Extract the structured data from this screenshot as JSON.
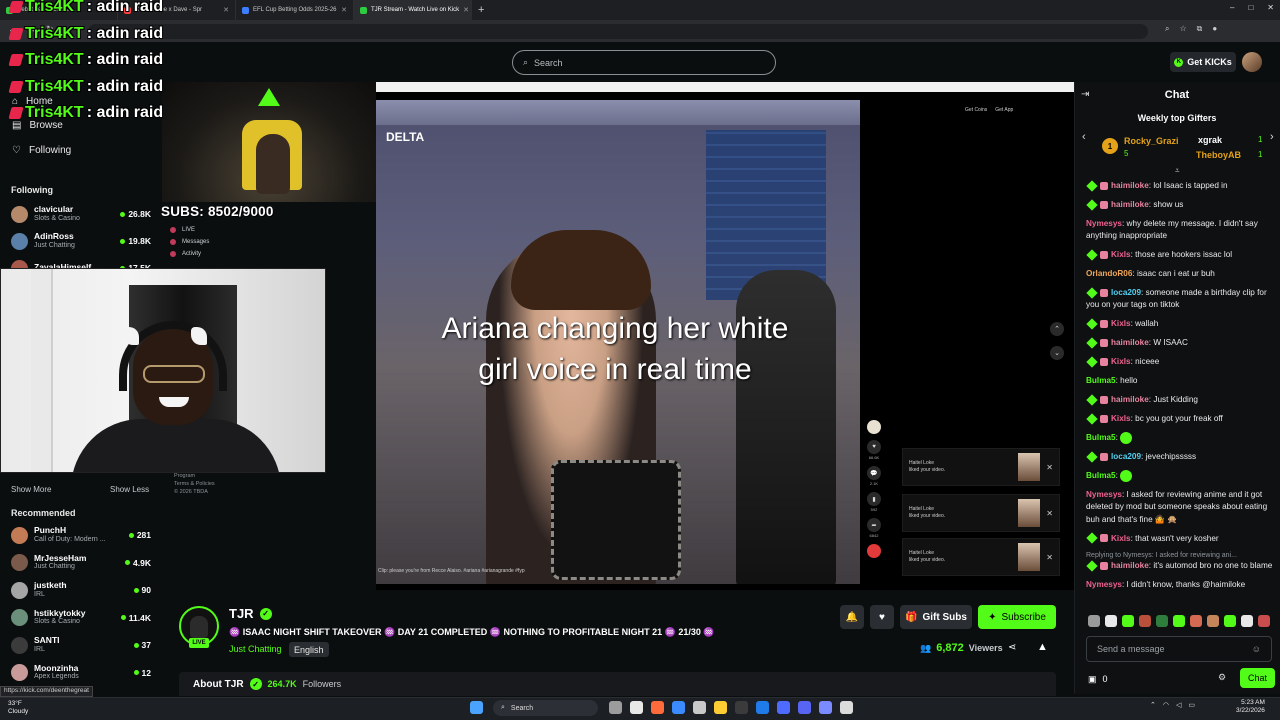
{
  "browser": {
    "tabs": [
      {
        "title": "Rebut Leaderboard",
        "active": false
      },
      {
        "title": "Central Cee x Dave - Spr",
        "active": false
      },
      {
        "title": "EFL Cup Betting Odds 2025-26",
        "active": false
      },
      {
        "title": "TJR Stream - Watch Live on Kick",
        "active": true
      }
    ],
    "newtab": "+",
    "status_url": "https://kick.com/deenthegreat"
  },
  "kick": {
    "search_placeholder": "Search",
    "get_kicks": "Get KICKs"
  },
  "overlay": {
    "raid_lines": [
      {
        "name": "Tris4KT",
        "text": ": adin raid"
      },
      {
        "name": "Tris4KT",
        "text": ": adin raid"
      },
      {
        "name": "Tris4KT",
        "text": ": adin raid"
      },
      {
        "name": "Tris4KT",
        "text": ": adin raid"
      },
      {
        "name": "Tris4KT",
        "text": ": adin raid"
      }
    ],
    "subs_goal": "SUBS: 8502/9000",
    "mini_panel": [
      "LIVE",
      "Messages",
      "Activity"
    ],
    "caption": "Ariana changing her white girl voice in real time",
    "video_bg_text": "DELTA"
  },
  "sidebar": {
    "nav": [
      {
        "label": "Home",
        "icon": "home-icon"
      },
      {
        "label": "Browse",
        "icon": "browse-icon"
      },
      {
        "label": "Following",
        "icon": "heart-icon"
      }
    ],
    "following_title": "Following",
    "following": [
      {
        "name": "clavicular",
        "category": "Slots & Casino",
        "viewers": "26.8K",
        "color": "#b48a6a"
      },
      {
        "name": "AdinRoss",
        "category": "Just Chatting",
        "viewers": "19.8K",
        "color": "#5a7fa8"
      },
      {
        "name": "ZavalaHimself",
        "category": "",
        "viewers": "17.5K",
        "color": "#a8584a"
      }
    ],
    "show_more": "Show More",
    "show_less": "Show Less",
    "recommended_title": "Recommended",
    "recommended": [
      {
        "name": "PunchH",
        "category": "Call of Duty: Modern ...",
        "viewers": "281",
        "color": "#c27b55"
      },
      {
        "name": "MrJesseHam",
        "category": "Just Chatting",
        "viewers": "4.9K",
        "color": "#7a5b4b"
      },
      {
        "name": "justketh",
        "category": "IRL",
        "viewers": "90",
        "color": "#a5a5a5"
      },
      {
        "name": "hstikkytokky",
        "category": "Slots & Casino",
        "viewers": "11.4K",
        "color": "#6a8f7a"
      },
      {
        "name": "SANTI",
        "category": "IRL",
        "viewers": "37",
        "color": "#3b3b3b"
      },
      {
        "name": "Moonzinha",
        "category": "Apex Legends",
        "viewers": "12",
        "color": "#c89a9a"
      }
    ],
    "footer_info": [
      "Program",
      "Terms & Policies",
      "© 2026 TBDA"
    ]
  },
  "stream": {
    "streamer": "TJR",
    "live": "LIVE",
    "title": "♒ ISAAC NIGHT SHIFT TAKEOVER ♒ DAY 21 COMPLETED ♒ NOTHING TO PROFITABLE NIGHT 21 ♒ 21/30 ♒",
    "category": "Just Chatting",
    "language": "English",
    "gift_subs": "Gift Subs",
    "subscribe": "Subscribe",
    "viewers": "6,872",
    "viewers_label": "Viewers",
    "about": "About TJR",
    "followers": "264.7K",
    "followers_label": "Followers"
  },
  "video_overlays": {
    "side_counts": [
      "66.6K",
      "2.1K",
      "592",
      "6842",
      "457"
    ],
    "notifications": [
      {
        "title": "Haitel Loke",
        "text": "liked your video."
      },
      {
        "title": "Haitel Loke",
        "text": "liked your video."
      },
      {
        "title": "Haitel Loke",
        "text": "liked your video."
      }
    ],
    "top_right": [
      "Get Coins",
      "Get App"
    ],
    "bottom_credit": "Clip: please you're from Recce Alaiso. #ariana #arianagrande #fyp"
  },
  "chat": {
    "title": "Chat",
    "gifters_title": "Weekly top Gifters",
    "gifters": [
      {
        "rank": "1",
        "name": "Rocky_Grazi",
        "count": "5",
        "color": "#e3a21a"
      },
      {
        "name": "xgrak",
        "count": "1",
        "color": "#ffffff"
      },
      {
        "name": "TheboyAB",
        "count": "1",
        "color": "#e3a21a"
      }
    ],
    "messages": [
      {
        "user": "haimiloke",
        "color": "#e7839f",
        "badges": true,
        "text": "lol Isaac is tapped in"
      },
      {
        "user": "haimiloke",
        "color": "#e7839f",
        "badges": true,
        "text": "show us"
      },
      {
        "user": "Nymesys",
        "color": "#f06290",
        "badges": false,
        "text": "why delete my message. I didn't say anything inappropriate"
      },
      {
        "user": "Kixls",
        "color": "#f06290",
        "badges": true,
        "text": "those are hookers issac lol"
      },
      {
        "user": "OrlandoR06",
        "color": "#f0a656",
        "badges": false,
        "text": "isaac can i eat ur buh"
      },
      {
        "user": "loca209",
        "color": "#53d0f0",
        "badges": true,
        "text": "someone made a birthday clip for you on your tags on tiktok"
      },
      {
        "user": "Kixls",
        "color": "#f06290",
        "badges": true,
        "text": "wallah"
      },
      {
        "user": "haimiloke",
        "color": "#e7839f",
        "badges": true,
        "text": "W ISAAC"
      },
      {
        "user": "Kixls",
        "color": "#f06290",
        "badges": true,
        "text": "niceee"
      },
      {
        "user": "Bulma5",
        "color": "#53fc18",
        "badges": false,
        "text": "hello"
      },
      {
        "user": "haimiloke",
        "color": "#e7839f",
        "badges": true,
        "text": "Just Kidding"
      },
      {
        "user": "Kixls",
        "color": "#f06290",
        "badges": true,
        "text": "bc you got your freak off"
      },
      {
        "user": "Bulma5",
        "color": "#53fc18",
        "badges": false,
        "text": "",
        "emote": true
      },
      {
        "user": "loca209",
        "color": "#53d0f0",
        "badges": true,
        "text": "jevechipsssss"
      },
      {
        "user": "Bulma5",
        "color": "#53fc18",
        "badges": false,
        "text": "",
        "emote": true
      },
      {
        "user": "Nymesys",
        "color": "#f06290",
        "badges": false,
        "text": "I asked for reviewing anime and it got deleted by mod but someone speaks about eating buh and that's fine 🤷 🙊"
      },
      {
        "user": "Kixls",
        "color": "#f06290",
        "badges": true,
        "text": "that wasn't very kosher"
      },
      {
        "user": "haimiloke",
        "color": "#e7839f",
        "badges": true,
        "reply": "Replying to Nymesys: I asked for reviewing ani...",
        "text": "it's automod bro no one to blame"
      },
      {
        "user": "Nymesys",
        "color": "#f06290",
        "badges": false,
        "text": "I didn't know, thanks @haimiloke"
      }
    ],
    "emote_colors": [
      "#9a9a9a",
      "#e8e8e8",
      "#53fc18",
      "#b9503b",
      "#2f7d3d",
      "#53fc18",
      "#d46a52",
      "#c5845a",
      "#53fc18",
      "#e8e8e8",
      "#c94d4d"
    ],
    "input_placeholder": "Send a message",
    "kicks_count": "0",
    "send_label": "Chat"
  },
  "taskbar": {
    "temp": "33°F",
    "weather": "Cloudy",
    "search": "Search",
    "time": "5:23 AM",
    "date": "3/22/2026",
    "icon_colors": [
      "#4aa3ff",
      "#9c9c9c",
      "#e8e8e8",
      "#ff6b3a",
      "#3b8bff",
      "#c9c9c9",
      "#ffcc33",
      "#3b3b3b",
      "#1f7be8",
      "#4f6bff",
      "#5865f2",
      "#7b8bff",
      "#dcdcdc"
    ]
  }
}
